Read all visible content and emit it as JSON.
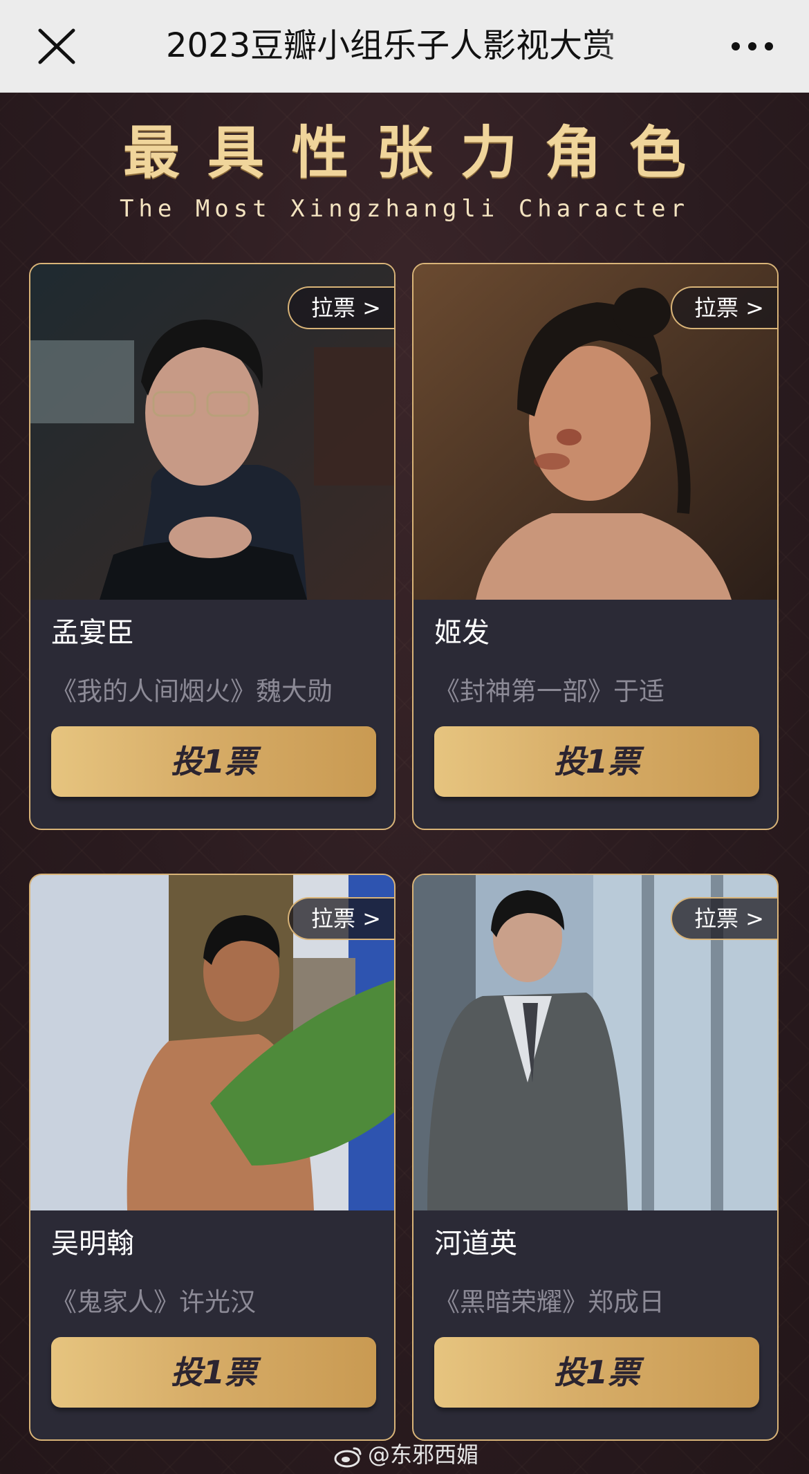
{
  "topbar": {
    "title": "2023豆瓣小组乐子人影视大赏",
    "close_icon": "close-icon",
    "more_icon": "more-icon"
  },
  "heading": {
    "cn": "最具性张力角色",
    "en": "The Most Xingzhangli Character"
  },
  "cards": [
    {
      "name": "孟宴臣",
      "role": "《我的人间烟火》魏大勋",
      "pull_vote": "拉票 >",
      "vote": "投1票"
    },
    {
      "name": "姬发",
      "role": "《封神第一部》于适",
      "pull_vote": "拉票 >",
      "vote": "投1票"
    },
    {
      "name": "吴明翰",
      "role": "《鬼家人》许光汉",
      "pull_vote": "拉票 >",
      "vote": "投1票"
    },
    {
      "name": "河道英",
      "role": "《黑暗荣耀》郑成日",
      "pull_vote": "拉票 >",
      "vote": "投1票"
    }
  ],
  "watermark": {
    "text": "@东邪西媚",
    "icon": "weibo-icon"
  },
  "colors": {
    "gold": "#d9b478",
    "card_bg": "#2b2a36",
    "page_bg": "#2b1c20"
  }
}
